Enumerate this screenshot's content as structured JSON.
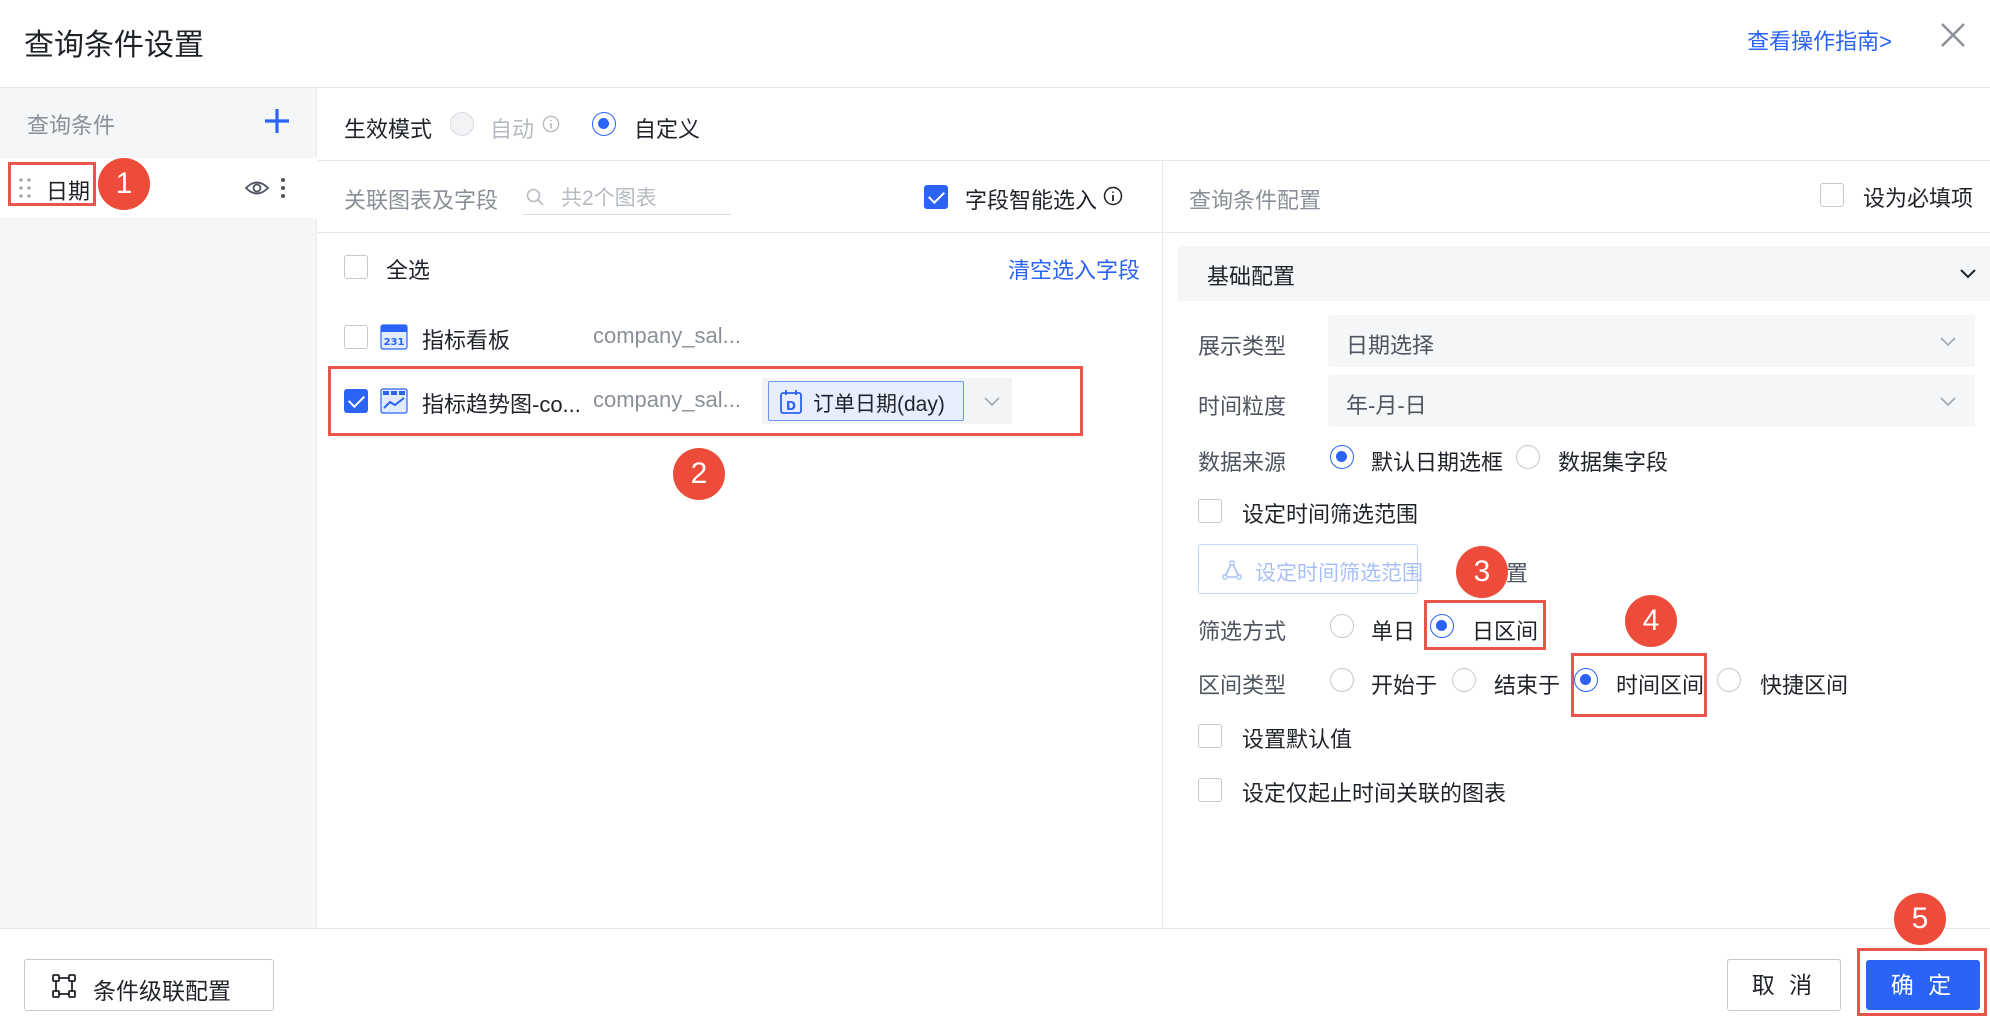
{
  "header": {
    "title": "查询条件设置",
    "guide_link": "查看操作指南>"
  },
  "left_panel": {
    "heading": "查询条件",
    "conditions": [
      {
        "label": "日期"
      }
    ]
  },
  "mode": {
    "label": "生效模式",
    "options": [
      {
        "label": "自动",
        "selected": false,
        "disabled": true
      },
      {
        "label": "自定义",
        "selected": true
      }
    ]
  },
  "association": {
    "title": "关联图表及字段",
    "search_placeholder": "共2个图表",
    "smart_select_label": "字段智能选入",
    "smart_select_checked": true,
    "select_all_label": "全选",
    "clear_label": "清空选入字段",
    "charts": [
      {
        "name": "指标看板",
        "dataset": "company_sal...",
        "checked": false,
        "icon": "calendar-231-icon"
      },
      {
        "name": "指标趋势图-co...",
        "dataset": "company_sal...",
        "checked": true,
        "icon": "trend-chart-icon",
        "field": "订单日期(day)"
      }
    ]
  },
  "config": {
    "title": "查询条件配置",
    "required_label": "设为必填项",
    "required_checked": false,
    "section_title": "基础配置",
    "display_type": {
      "label": "展示类型",
      "value": "日期选择"
    },
    "granularity": {
      "label": "时间粒度",
      "value": "年-月-日"
    },
    "data_source": {
      "label": "数据来源",
      "options": [
        {
          "label": "默认日期选框",
          "selected": true
        },
        {
          "label": "数据集字段",
          "selected": false
        }
      ]
    },
    "set_range_checkbox": "设定时间筛选范围",
    "set_range_button": "设定时间筛选范围",
    "set_range_suffix": "置",
    "filter_mode": {
      "label": "筛选方式",
      "options": [
        {
          "label": "单日",
          "selected": false
        },
        {
          "label": "日区间",
          "selected": true
        }
      ]
    },
    "range_type": {
      "label": "区间类型",
      "options": [
        {
          "label": "开始于",
          "selected": false
        },
        {
          "label": "结束于",
          "selected": false
        },
        {
          "label": "时间区间",
          "selected": true
        },
        {
          "label": "快捷区间",
          "selected": false
        }
      ]
    },
    "default_value_label": "设置默认值",
    "only_start_end_label": "设定仅起止时间关联的图表"
  },
  "footer": {
    "cascade_label": "条件级联配置",
    "cancel_label": "取 消",
    "ok_label": "确 定"
  },
  "annotations": [
    "1",
    "2",
    "3",
    "4",
    "5"
  ],
  "colors": {
    "accent": "#2a63f6",
    "annotation": "#ee4c3a"
  }
}
